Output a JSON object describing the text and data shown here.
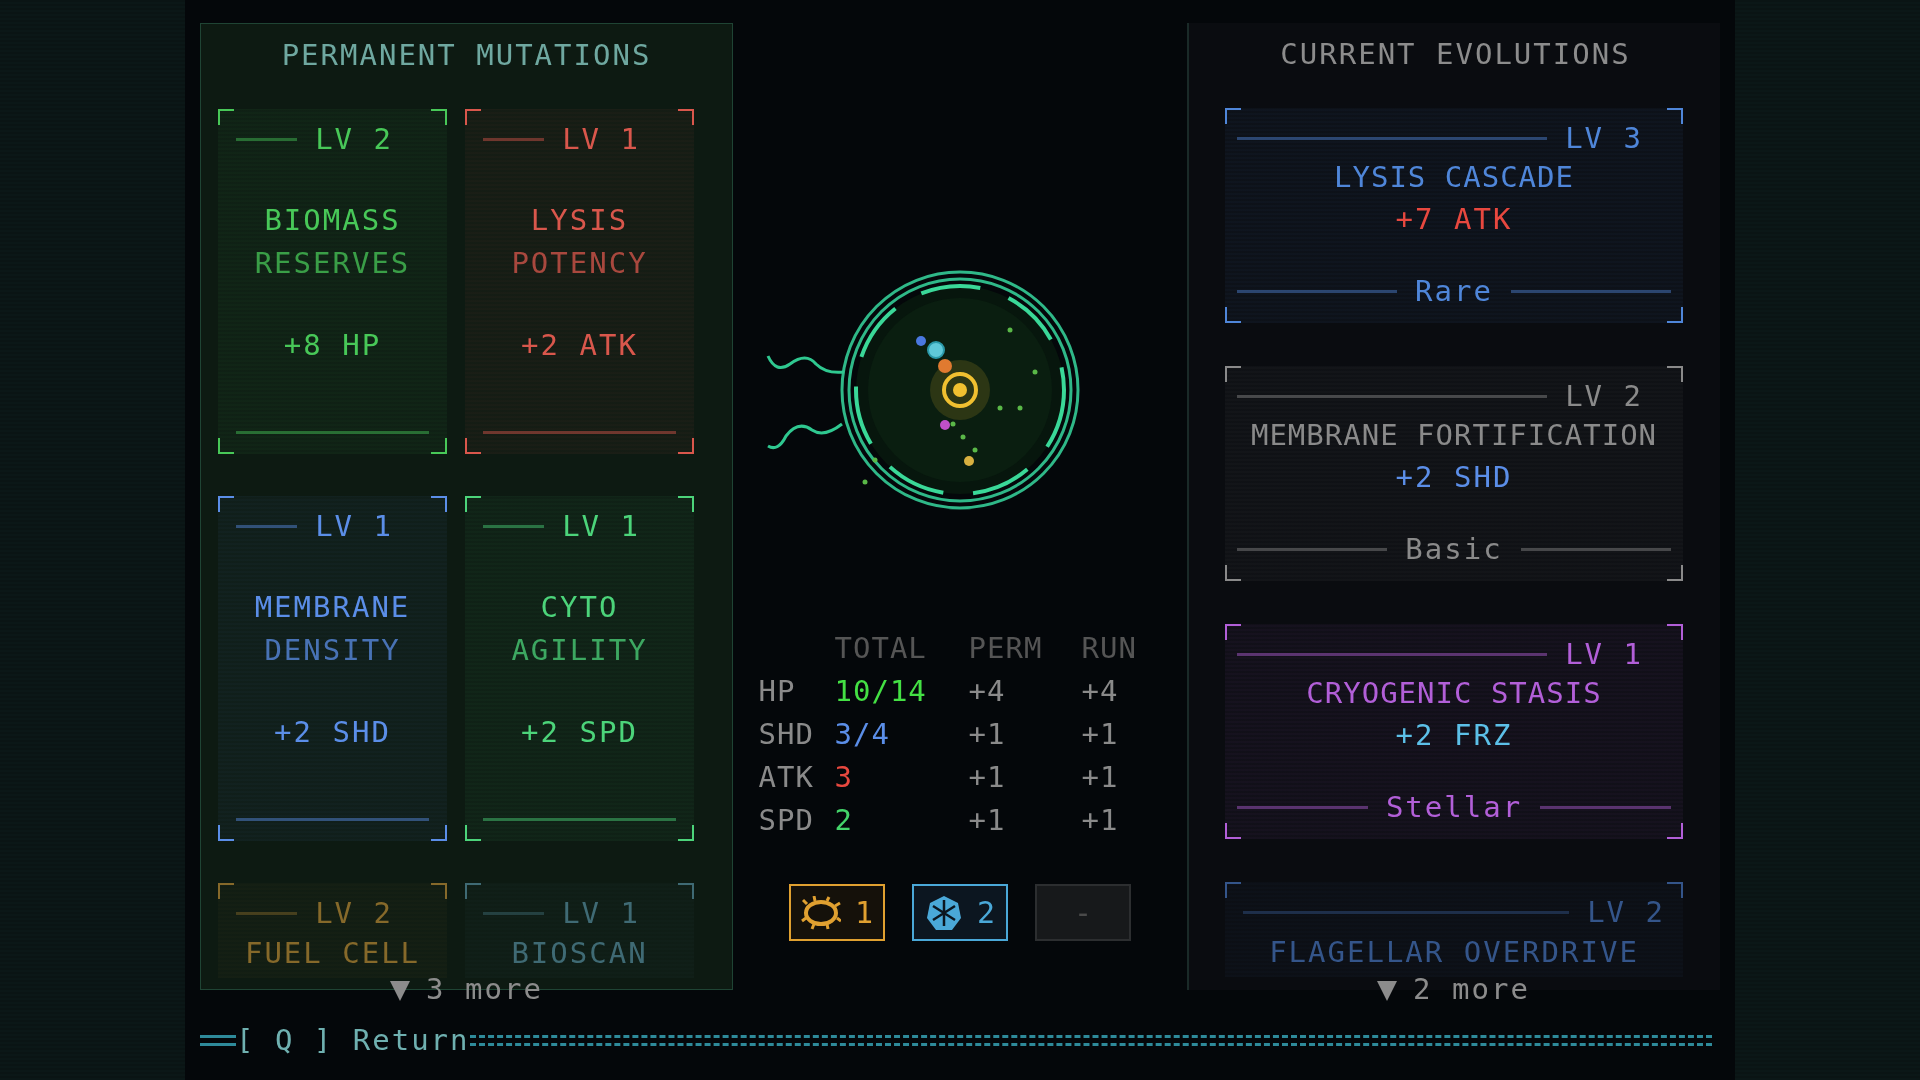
{
  "mutations": {
    "title": "PERMANENT MUTATIONS",
    "cards": [
      {
        "kind": "card",
        "level": "LV 2",
        "name": [
          "BIOMASS",
          "RESERVES"
        ],
        "effect": "+8 HP",
        "color": "#48c858"
      },
      {
        "kind": "card",
        "level": "LV 1",
        "name": [
          "LYSIS",
          "POTENCY"
        ],
        "effect": "+2 ATK",
        "color": "#d9574c"
      },
      {
        "kind": "card",
        "level": "LV 1",
        "name": [
          "MEMBRANE",
          "DENSITY"
        ],
        "effect": "+2 SHD",
        "color": "#5b8ee8"
      },
      {
        "kind": "card",
        "level": "LV 1",
        "name": [
          "CYTO",
          "AGILITY"
        ],
        "effect": "+2 SPD",
        "color": "#4cd47a"
      },
      {
        "kind": "peek",
        "level": "LV 2",
        "name": [
          "FUEL CELL"
        ],
        "color": "#86692a"
      },
      {
        "kind": "peek",
        "level": "LV 1",
        "name": [
          "BIOSCAN"
        ],
        "color": "#3f6a74"
      }
    ],
    "more": "3 more"
  },
  "stats": {
    "columns": [
      "TOTAL",
      "PERM",
      "RUN"
    ],
    "rows": [
      {
        "label": "HP",
        "total": "10/14",
        "color": "#44e044",
        "perm": "+4",
        "run": "+4"
      },
      {
        "label": "SHD",
        "total": "3/4",
        "color": "#5b8ee8",
        "perm": "+1",
        "run": "+1"
      },
      {
        "label": "ATK",
        "total": "3",
        "color": "#e8483f",
        "perm": "+1",
        "run": "+1"
      },
      {
        "label": "SPD",
        "total": "2",
        "color": "#44d46a",
        "perm": "+1",
        "run": "+1"
      }
    ]
  },
  "chips": [
    {
      "kind": "thorns",
      "count": "1",
      "color": "#e0a030"
    },
    {
      "kind": "snowflake",
      "count": "2",
      "color": "#4aa8d8"
    },
    {
      "kind": "empty",
      "count": "-",
      "color": "#2c2e30"
    }
  ],
  "evolutions": {
    "title": "CURRENT EVOLUTIONS",
    "cards": [
      {
        "kind": "card",
        "level": "LV 3",
        "name": "LYSIS CASCADE",
        "effect": {
          "text": "+7 ATK",
          "color": "#e8483f"
        },
        "rarity": "Rare",
        "color": "#4f86d9"
      },
      {
        "kind": "card",
        "level": "LV 2",
        "name": "MEMBRANE FORTIFICATION",
        "effect": {
          "text": "+2 SHD",
          "color": "#5b8ee8"
        },
        "rarity": "Basic",
        "color": "#8a8a8a"
      },
      {
        "kind": "card",
        "level": "LV 1",
        "name": "CRYOGENIC STASIS",
        "effect": {
          "text": "+2 FRZ",
          "color": "#5cc0e8"
        },
        "rarity": "Stellar",
        "color": "#b25fd8"
      },
      {
        "kind": "peek",
        "level": "LV 2",
        "name": "FLAGELLAR OVERDRIVE",
        "color": "#34558a"
      }
    ],
    "more": "2 more"
  },
  "footer": {
    "key_hint": "[ Q ] Return"
  }
}
